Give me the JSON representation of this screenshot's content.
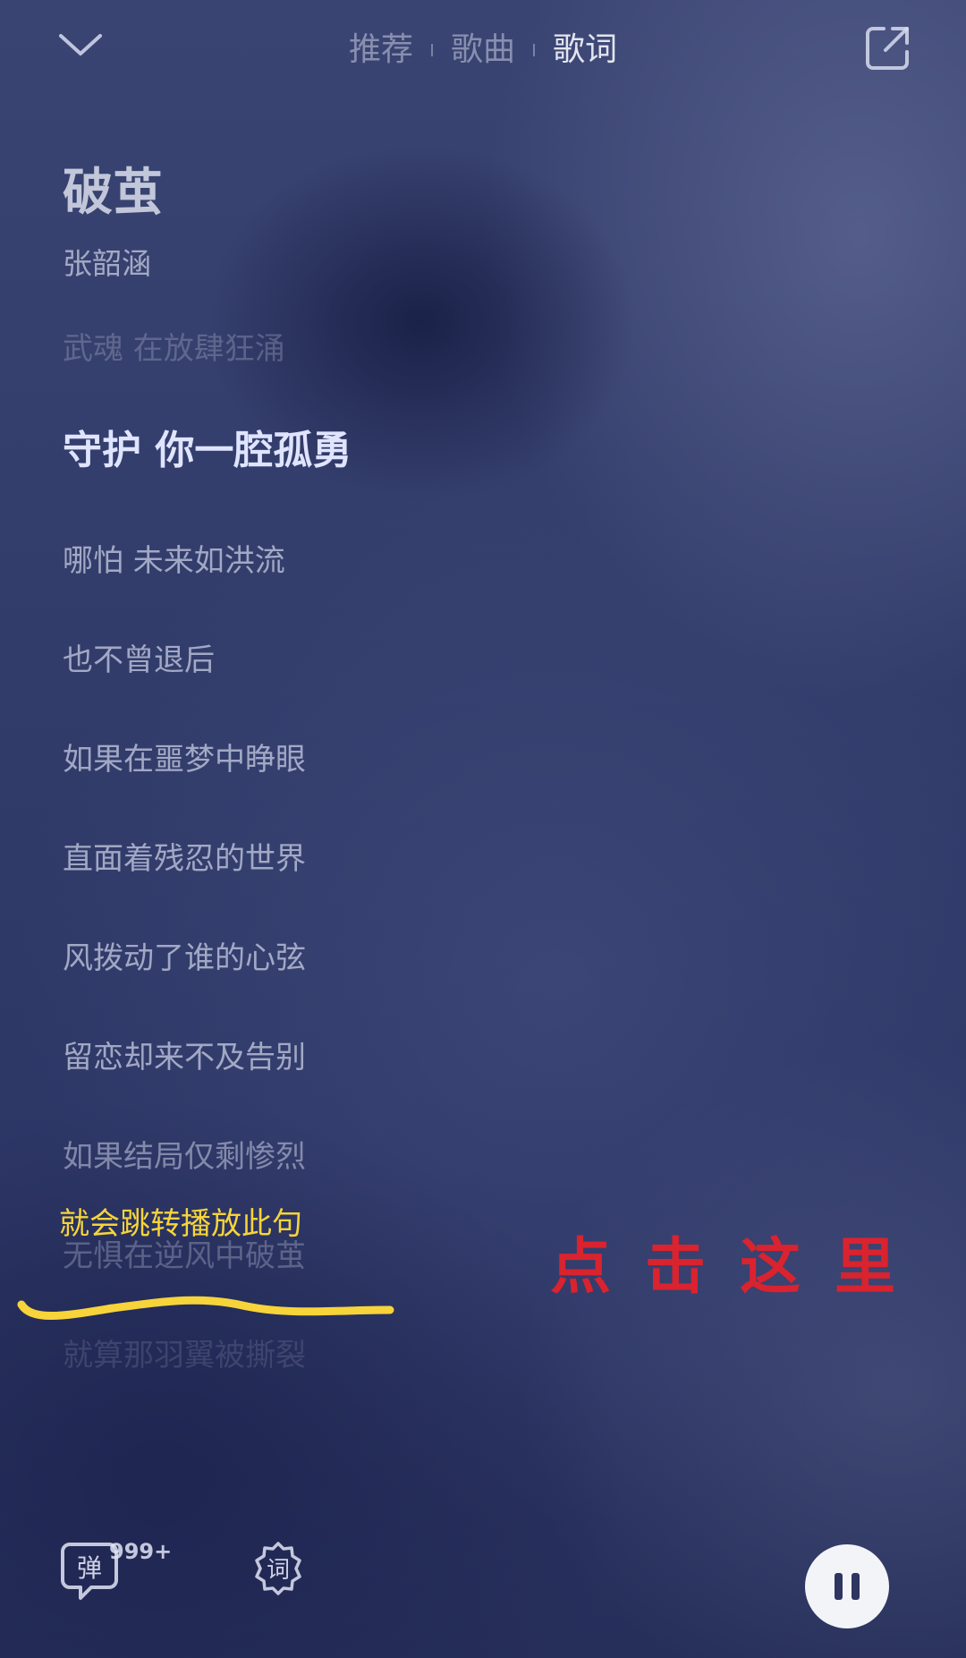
{
  "header": {
    "tabs": [
      {
        "label": "推荐"
      },
      {
        "label": "歌曲"
      },
      {
        "label": "歌词"
      }
    ],
    "active_tab": "歌词",
    "collapse_icon": "chevron-down-icon",
    "share_icon": "share-external-icon"
  },
  "song": {
    "title": "破茧",
    "artist": "张韶涵"
  },
  "lyrics": {
    "lines": [
      "武魂 在放肆狂涌",
      "守护 你一腔孤勇",
      "哪怕 未来如洪流",
      "也不曾退后",
      "如果在噩梦中睁眼",
      "直面着残忍的世界",
      "风拨动了谁的心弦",
      "留恋却来不及告别",
      "如果结局仅剩惨烈",
      "无惧在逆风中破茧",
      "就算那羽翼被撕裂"
    ],
    "current_index": 1
  },
  "annotations": {
    "yellow_note": "就会跳转播放此句",
    "red_note": "点击这里",
    "yellow_color": "#f6d43a",
    "red_color": "#d9232f"
  },
  "bottom_bar": {
    "danmu_label": "弹",
    "danmu_count": "999+",
    "lyric_mode_label": "词",
    "pause_icon": "pause-icon"
  }
}
